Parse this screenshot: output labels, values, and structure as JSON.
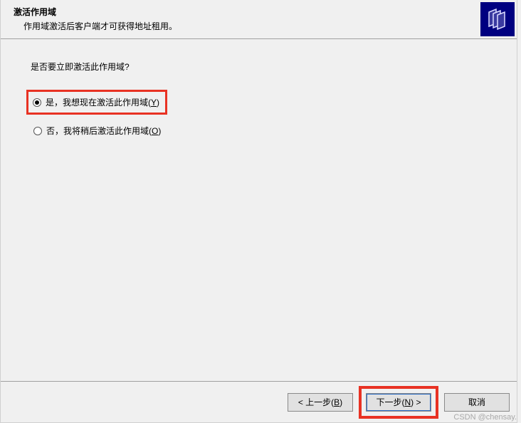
{
  "header": {
    "title": "激活作用域",
    "subtitle": "作用域激活后客户端才可获得地址租用。"
  },
  "content": {
    "question": "是否要立即激活此作用域?",
    "options": {
      "yes": {
        "label": "是，我想现在激活此作用域(",
        "accel": "Y",
        "suffix": ")",
        "selected": true,
        "highlighted": true
      },
      "no": {
        "label": "否，我将稍后激活此作用域(",
        "accel": "O",
        "suffix": ")",
        "selected": false,
        "highlighted": false
      }
    }
  },
  "footer": {
    "back": {
      "prefix": "< 上一步(",
      "accel": "B",
      "suffix": ")",
      "highlighted": false
    },
    "next": {
      "prefix": "下一步(",
      "accel": "N",
      "suffix": ") >",
      "highlighted": true,
      "default": true
    },
    "cancel": {
      "label": "取消",
      "highlighted": false
    }
  },
  "watermark": "CSDN @chensay."
}
